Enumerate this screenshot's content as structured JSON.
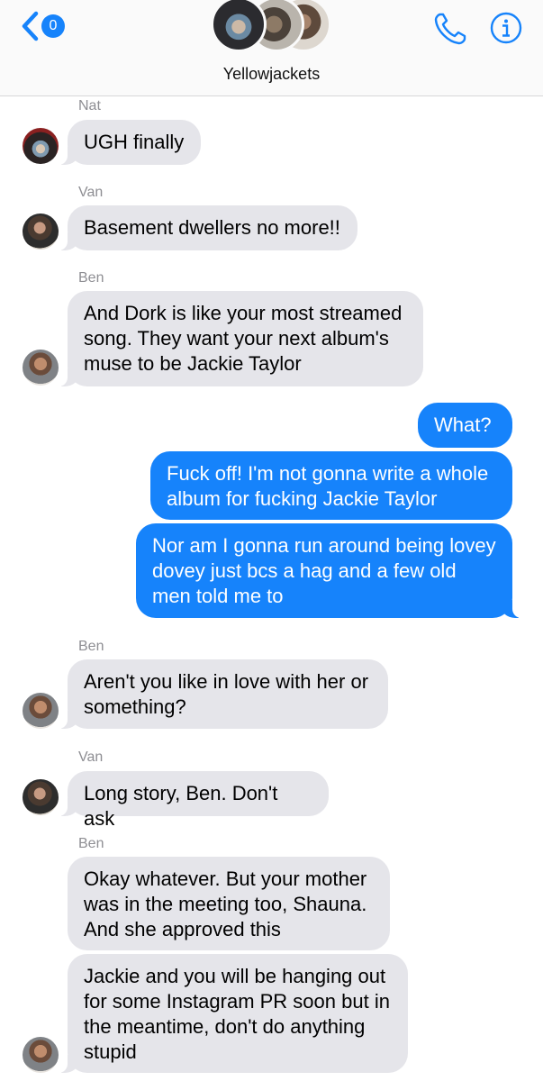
{
  "header": {
    "back_badge": "0",
    "group_name": "Yellowjackets"
  },
  "messages": [
    {
      "sender": "Nat",
      "text": "UGH finally"
    },
    {
      "sender": "Van",
      "text": "Basement dwellers no more!!"
    },
    {
      "sender": "Ben",
      "text": "And Dork is like your most streamed song. They want your next album's muse to be Jackie Taylor"
    },
    {
      "sender": "",
      "text": "What?"
    },
    {
      "sender": "",
      "text": "Fuck off! I'm not gonna write a whole album for fucking Jackie Taylor"
    },
    {
      "sender": "",
      "text": "Nor am I gonna run around being lovey dovey just bcs a hag and a few old men told me to"
    },
    {
      "sender": "Ben",
      "text": "Aren't you like in love with her or something?"
    },
    {
      "sender": "Van",
      "text": "Long story, Ben. Don't ask"
    },
    {
      "sender": "Ben",
      "text": "Okay whatever. But your mother was in the meeting too, Shauna. And she approved this"
    },
    {
      "sender": "",
      "text": "Jackie and you will be hanging out for some Instagram PR soon but in the meantime, don't do anything stupid"
    }
  ],
  "colors": {
    "outgoing_bubble": "#1683fb",
    "incoming_bubble": "#e5e5ea",
    "accent": "#1683fb"
  },
  "icons": [
    "back-chevron-icon",
    "phone-icon",
    "info-icon"
  ]
}
